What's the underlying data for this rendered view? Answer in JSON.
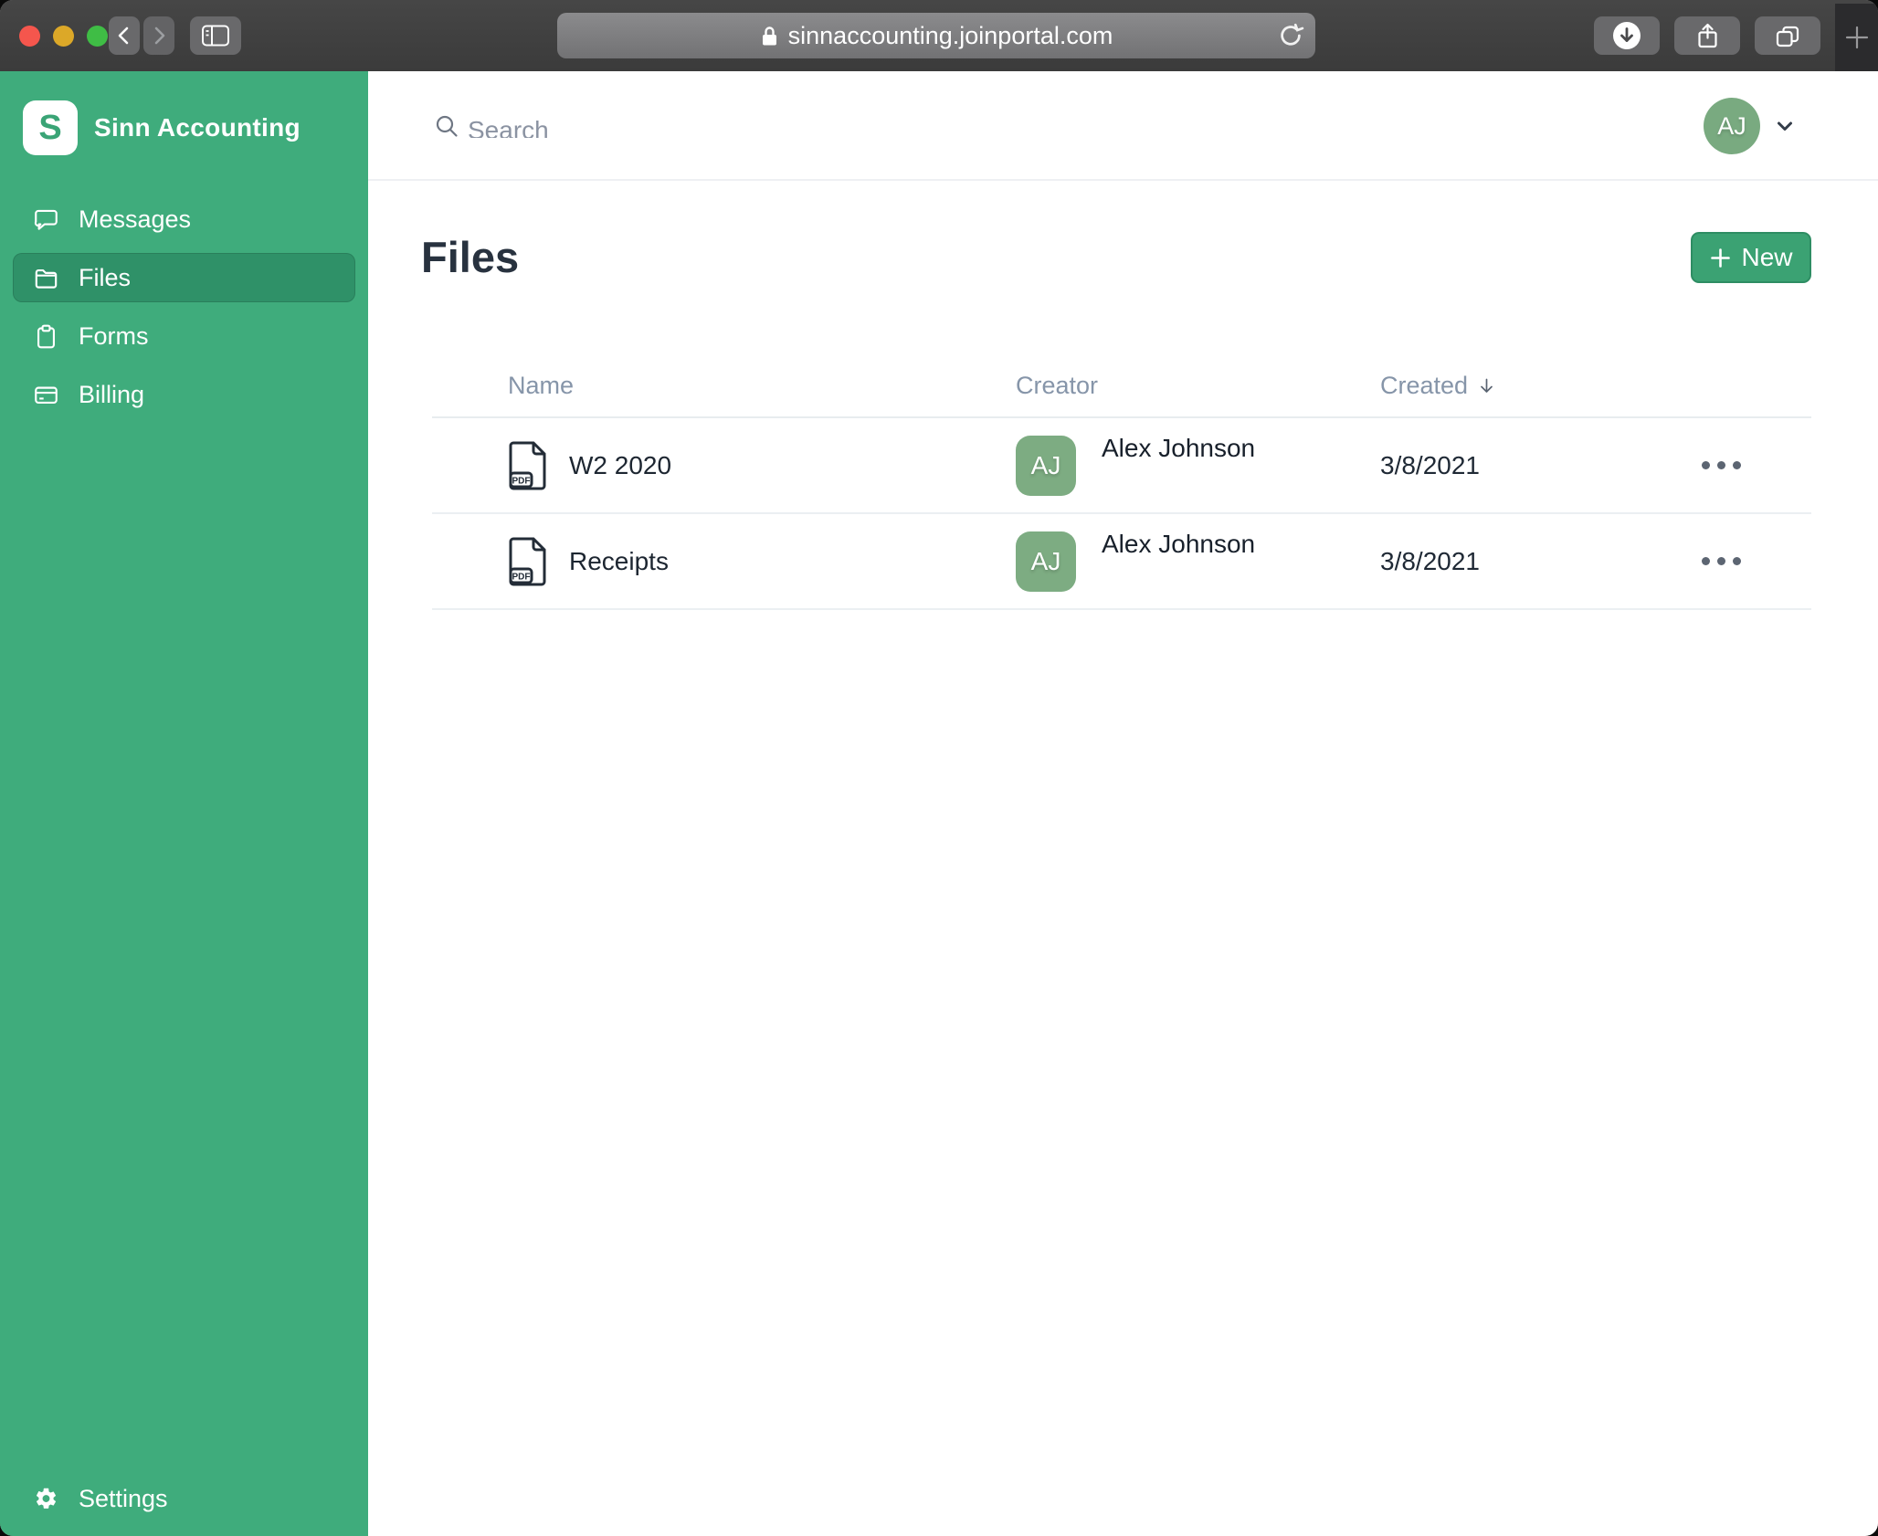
{
  "browser": {
    "url": "sinnaccounting.joinportal.com"
  },
  "sidebar": {
    "logo_initial": "S",
    "brand": "Sinn Accounting",
    "items": [
      {
        "label": "Messages",
        "icon": "chat-bubble-icon",
        "active": false
      },
      {
        "label": "Files",
        "icon": "folder-icon",
        "active": true
      },
      {
        "label": "Forms",
        "icon": "clipboard-icon",
        "active": false
      },
      {
        "label": "Billing",
        "icon": "credit-card-icon",
        "active": false
      }
    ],
    "settings_label": "Settings"
  },
  "header": {
    "search_placeholder": "Search",
    "user_initials": "AJ"
  },
  "content": {
    "title": "Files",
    "new_button_label": "New",
    "table": {
      "columns": {
        "name": "Name",
        "creator": "Creator",
        "created": "Created"
      },
      "sorted_by": "Created",
      "sort_direction": "descending",
      "rows": [
        {
          "file_type": "PDF",
          "name": "W2 2020",
          "creator_initials": "AJ",
          "creator_name": "Alex Johnson",
          "created": "3/8/2021"
        },
        {
          "file_type": "PDF",
          "name": "Receipts",
          "creator_initials": "AJ",
          "creator_name": "Alex Johnson",
          "created": "3/8/2021"
        }
      ]
    }
  },
  "colors": {
    "sidebar_green": "#3fac7c",
    "sidebar_active_green": "#2f9168",
    "button_green": "#3ba273",
    "avatar_green": "#7dac82",
    "title_text": "#28323f"
  }
}
